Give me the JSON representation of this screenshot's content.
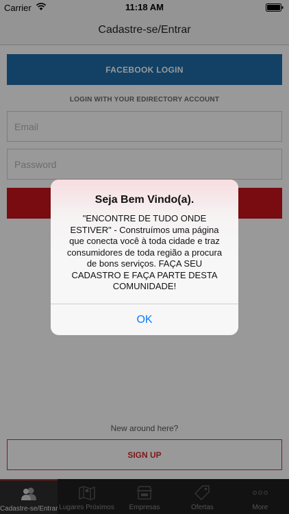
{
  "status_bar": {
    "carrier": "Carrier",
    "time": "11:18 AM"
  },
  "nav": {
    "title": "Cadastre-se/Entrar"
  },
  "login": {
    "facebook_label": "FACEBOOK LOGIN",
    "caption": "LOGIN WITH YOUR EDIRECTORY ACCOUNT",
    "email_placeholder": "Email",
    "password_placeholder": "Password"
  },
  "signup": {
    "prompt": "New around here?",
    "button_label": "SIGN UP"
  },
  "alert": {
    "title": "Seja Bem Vindo(a).",
    "message": "\"ENCONTRE DE TUDO ONDE ESTIVER\" - Construímos uma página que conecta você à toda cidade e traz consumidores de toda região a procura de bons serviços. FAÇA SEU CADASTRO E FAÇA PARTE DESTA COMUNIDADE!",
    "ok_label": "OK"
  },
  "tabs": [
    {
      "label": "Cadastre-se/Entrar",
      "icon": "users-icon",
      "active": true
    },
    {
      "label": "Lugares Próximos",
      "icon": "map-icon",
      "active": false
    },
    {
      "label": "Empresas",
      "icon": "store-icon",
      "active": false
    },
    {
      "label": "Ofertas",
      "icon": "tag-icon",
      "active": false
    },
    {
      "label": "More",
      "icon": "more-icon",
      "active": false
    }
  ],
  "colors": {
    "brand_red": "#c8141c",
    "facebook_blue": "#1f6da8",
    "ios_blue": "#0a7aff",
    "tab_bar": "#1e1e1e"
  }
}
